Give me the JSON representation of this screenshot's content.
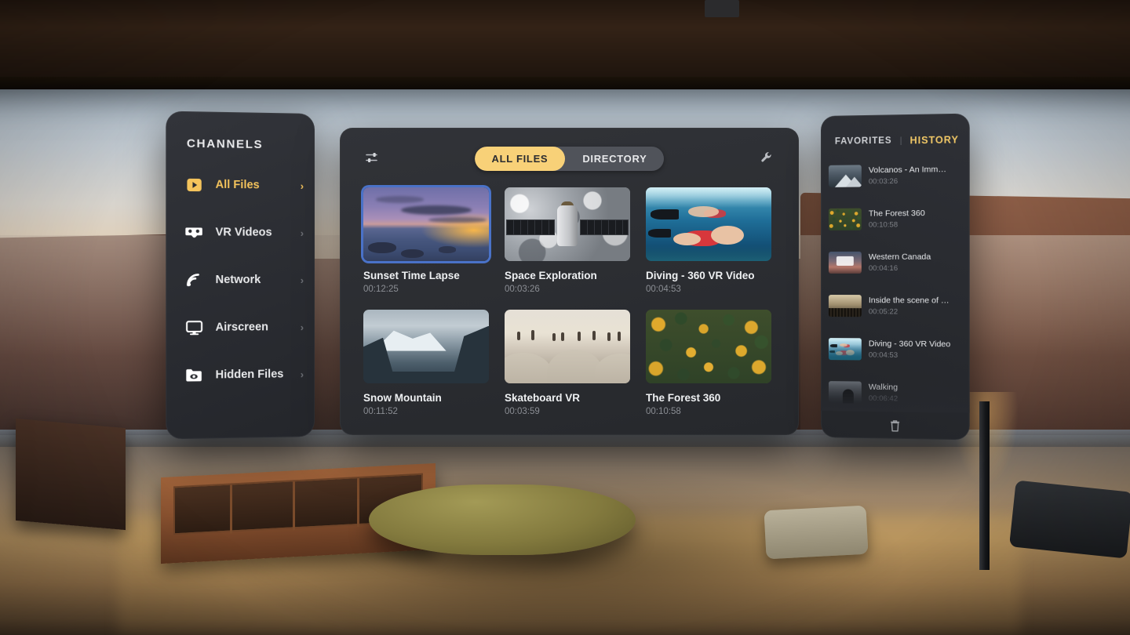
{
  "sidebar": {
    "title": "CHANNELS",
    "items": [
      {
        "label": "All Files",
        "icon": "play-file-icon",
        "active": true,
        "arrow": "›"
      },
      {
        "label": "VR Videos",
        "icon": "vr-headset-icon",
        "active": false,
        "arrow": "›"
      },
      {
        "label": "Network",
        "icon": "network-wifi-icon",
        "active": false,
        "arrow": "›"
      },
      {
        "label": "Airscreen",
        "icon": "monitor-icon",
        "active": false,
        "arrow": "›"
      },
      {
        "label": "Hidden Files",
        "icon": "folder-eye-icon",
        "active": false,
        "arrow": "›"
      }
    ]
  },
  "main": {
    "filter_icon": "sliders-icon",
    "settings_icon": "wrench-icon",
    "tabs": [
      {
        "label": "ALL FILES",
        "active": true
      },
      {
        "label": "DIRECTORY",
        "active": false
      }
    ],
    "files": [
      {
        "title": "Sunset Time Lapse",
        "duration": "00:12:25",
        "art": "art-sunset",
        "selected": true
      },
      {
        "title": "Space Exploration",
        "duration": "00:03:26",
        "art": "art-space",
        "selected": false
      },
      {
        "title": "Diving - 360 VR Video",
        "duration": "00:04:53",
        "art": "art-diving",
        "selected": false
      },
      {
        "title": "Snow Mountain",
        "duration": "00:11:52",
        "art": "art-snow",
        "selected": false
      },
      {
        "title": "Skateboard VR",
        "duration": "00:03:59",
        "art": "art-skate",
        "selected": false
      },
      {
        "title": "The Forest 360",
        "duration": "00:10:58",
        "art": "art-forest",
        "selected": false
      }
    ]
  },
  "history": {
    "tabs": [
      {
        "label": "FAVORITES",
        "active": false
      },
      {
        "label": "HISTORY",
        "active": true
      }
    ],
    "separator": "|",
    "trash_icon": "trash-icon",
    "items": [
      {
        "title": "Volcanos - An Imm…",
        "duration": "00:03:26",
        "art": "art-volcano"
      },
      {
        "title": "The Forest 360",
        "duration": "00:10:58",
        "art": "art-forest"
      },
      {
        "title": "Western Canada",
        "duration": "00:04:16",
        "art": "art-canada"
      },
      {
        "title": "Inside the scene of …",
        "duration": "00:05:22",
        "art": "art-inside"
      },
      {
        "title": "Diving - 360 VR Video",
        "duration": "00:04:53",
        "art": "art-diving"
      },
      {
        "title": "Walking",
        "duration": "00:06:42",
        "art": "art-walking"
      }
    ]
  },
  "colors": {
    "accent": "#f5c45c",
    "tab_active_bg": "#f8d178",
    "panel_bg": "#2a2c31",
    "selection_border": "#4a72c8",
    "text_primary": "#e8e9eb",
    "text_muted": "#8b8e94"
  }
}
